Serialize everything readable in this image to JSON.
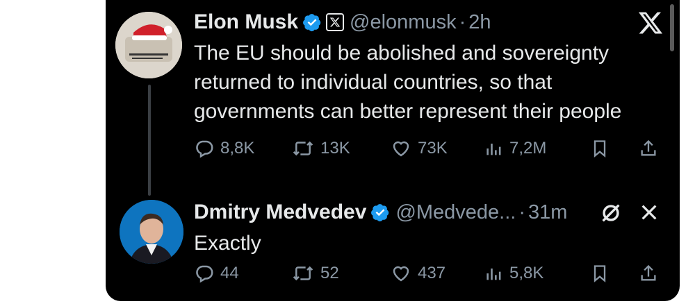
{
  "tweet1": {
    "name": "Elon Musk",
    "handle": "@elonmusk",
    "time": "2h",
    "text_lines": [
      "The EU should be abolished and sovereignty",
      "returned to individual countries, so that",
      "governments can better represent their people"
    ],
    "replies": "8,8K",
    "reposts": "13K",
    "likes": "73K",
    "views": "7,2M",
    "badge_icon": "verified-badge",
    "affiliate_icon": "x-logo"
  },
  "tweet2": {
    "name": "Dmitry Medvedev",
    "handle": "@Medvede...",
    "time": "31m",
    "text": "Exactly",
    "replies": "44",
    "reposts": "52",
    "likes": "437",
    "views": "5,8K",
    "badge_icon": "verified-badge"
  },
  "separator": "·",
  "colors": {
    "background": "#000000",
    "text": "#e7e9ea",
    "muted": "#8b98a5",
    "verified": "#1d9bf0"
  }
}
